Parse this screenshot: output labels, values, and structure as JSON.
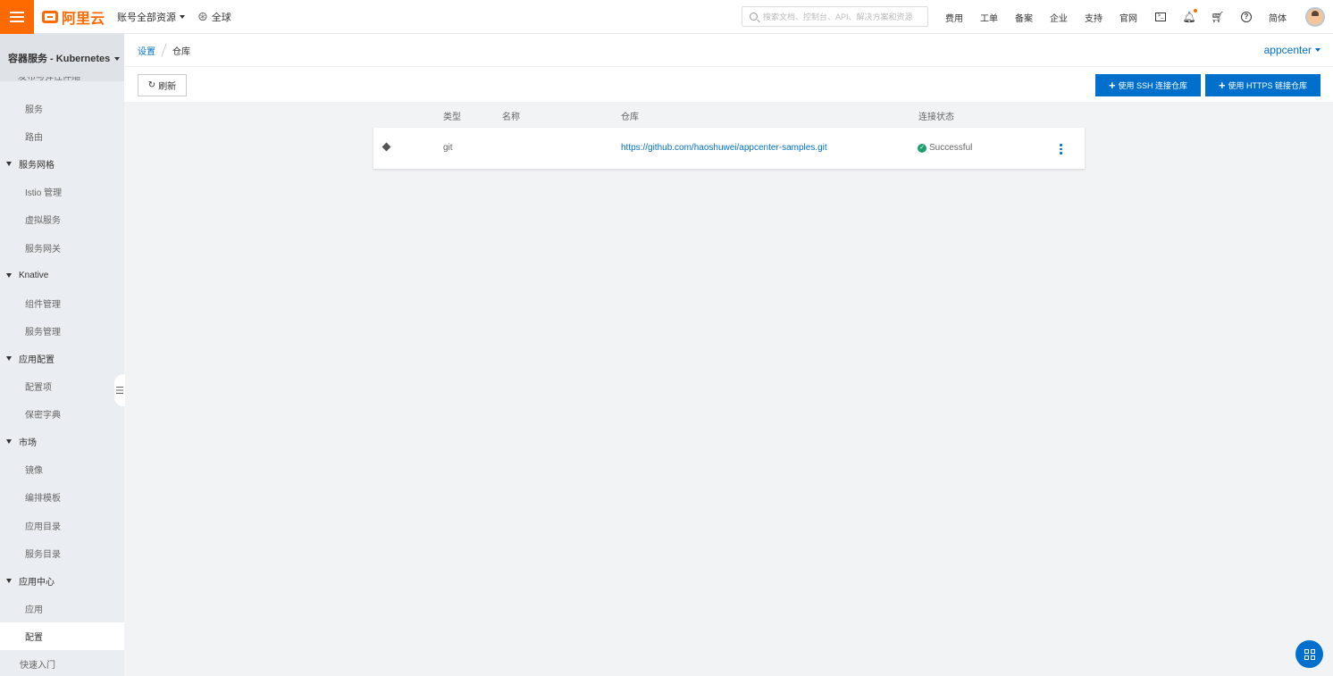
{
  "topbar": {
    "logo_text": "阿里云",
    "account_label": "账号全部资源",
    "region_label": "全球",
    "search_placeholder": "搜索文档、控制台、API、解决方案和资源",
    "nav": [
      "费用",
      "工单",
      "备案",
      "企业",
      "支持",
      "官网"
    ],
    "lang": "简体",
    "accent_color": "#ff6a00"
  },
  "sidebar": {
    "title": "容器服务 - Kubernetes",
    "cut_item": "发布与弹性伸缩",
    "items": [
      {
        "label": "服务",
        "type": "child"
      },
      {
        "label": "路由",
        "type": "child"
      },
      {
        "label": "服务网格",
        "type": "group"
      },
      {
        "label": "Istio 管理",
        "type": "child"
      },
      {
        "label": "虚拟服务",
        "type": "child"
      },
      {
        "label": "服务网关",
        "type": "child"
      },
      {
        "label": "Knative",
        "type": "group"
      },
      {
        "label": "组件管理",
        "type": "child"
      },
      {
        "label": "服务管理",
        "type": "child"
      },
      {
        "label": "应用配置",
        "type": "group"
      },
      {
        "label": "配置项",
        "type": "child"
      },
      {
        "label": "保密字典",
        "type": "child"
      },
      {
        "label": "市场",
        "type": "group"
      },
      {
        "label": "镜像",
        "type": "child"
      },
      {
        "label": "编排模板",
        "type": "child"
      },
      {
        "label": "应用目录",
        "type": "child"
      },
      {
        "label": "服务目录",
        "type": "child"
      },
      {
        "label": "应用中心",
        "type": "group"
      },
      {
        "label": "应用",
        "type": "child"
      },
      {
        "label": "配置",
        "type": "child",
        "active": true
      },
      {
        "label": "快速入门",
        "type": "plain"
      }
    ]
  },
  "breadcrumb": {
    "parent": "设置",
    "current": "仓库"
  },
  "namespace": "appcenter",
  "toolbar": {
    "refresh_label": "刷新",
    "ssh_button": "使用 SSH 连接仓库",
    "https_button": "使用 HTTPS 链接仓库"
  },
  "table": {
    "headers": {
      "type": "类型",
      "name": "名称",
      "repo": "仓库",
      "status": "连接状态"
    },
    "rows": [
      {
        "type": "git",
        "name": "",
        "repo": "https://github.com/haoshuwei/appcenter-samples.git",
        "status": "Successful"
      }
    ]
  },
  "colors": {
    "primary": "#0070cc",
    "success": "#1e9f6c"
  }
}
